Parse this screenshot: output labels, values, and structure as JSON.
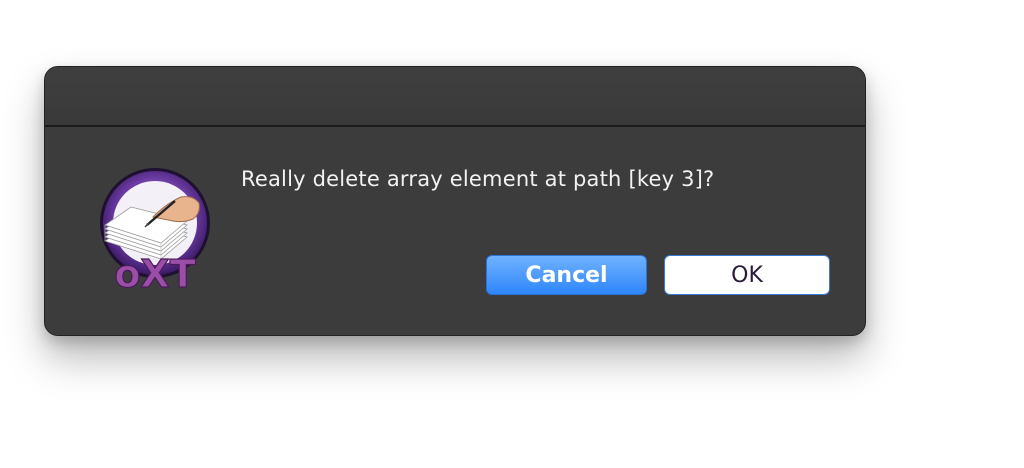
{
  "dialog": {
    "message": "Really delete array element at path [key 3]?",
    "app_icon": {
      "name": "oxt-app-icon",
      "text": "oXT"
    },
    "buttons": {
      "cancel_label": "Cancel",
      "ok_label": "OK"
    }
  },
  "colors": {
    "dialog_background": "#3c3c3c",
    "cancel_button": "#2f86fb",
    "ok_button": "#ffffff",
    "icon_logo": "#9b4ea8"
  }
}
